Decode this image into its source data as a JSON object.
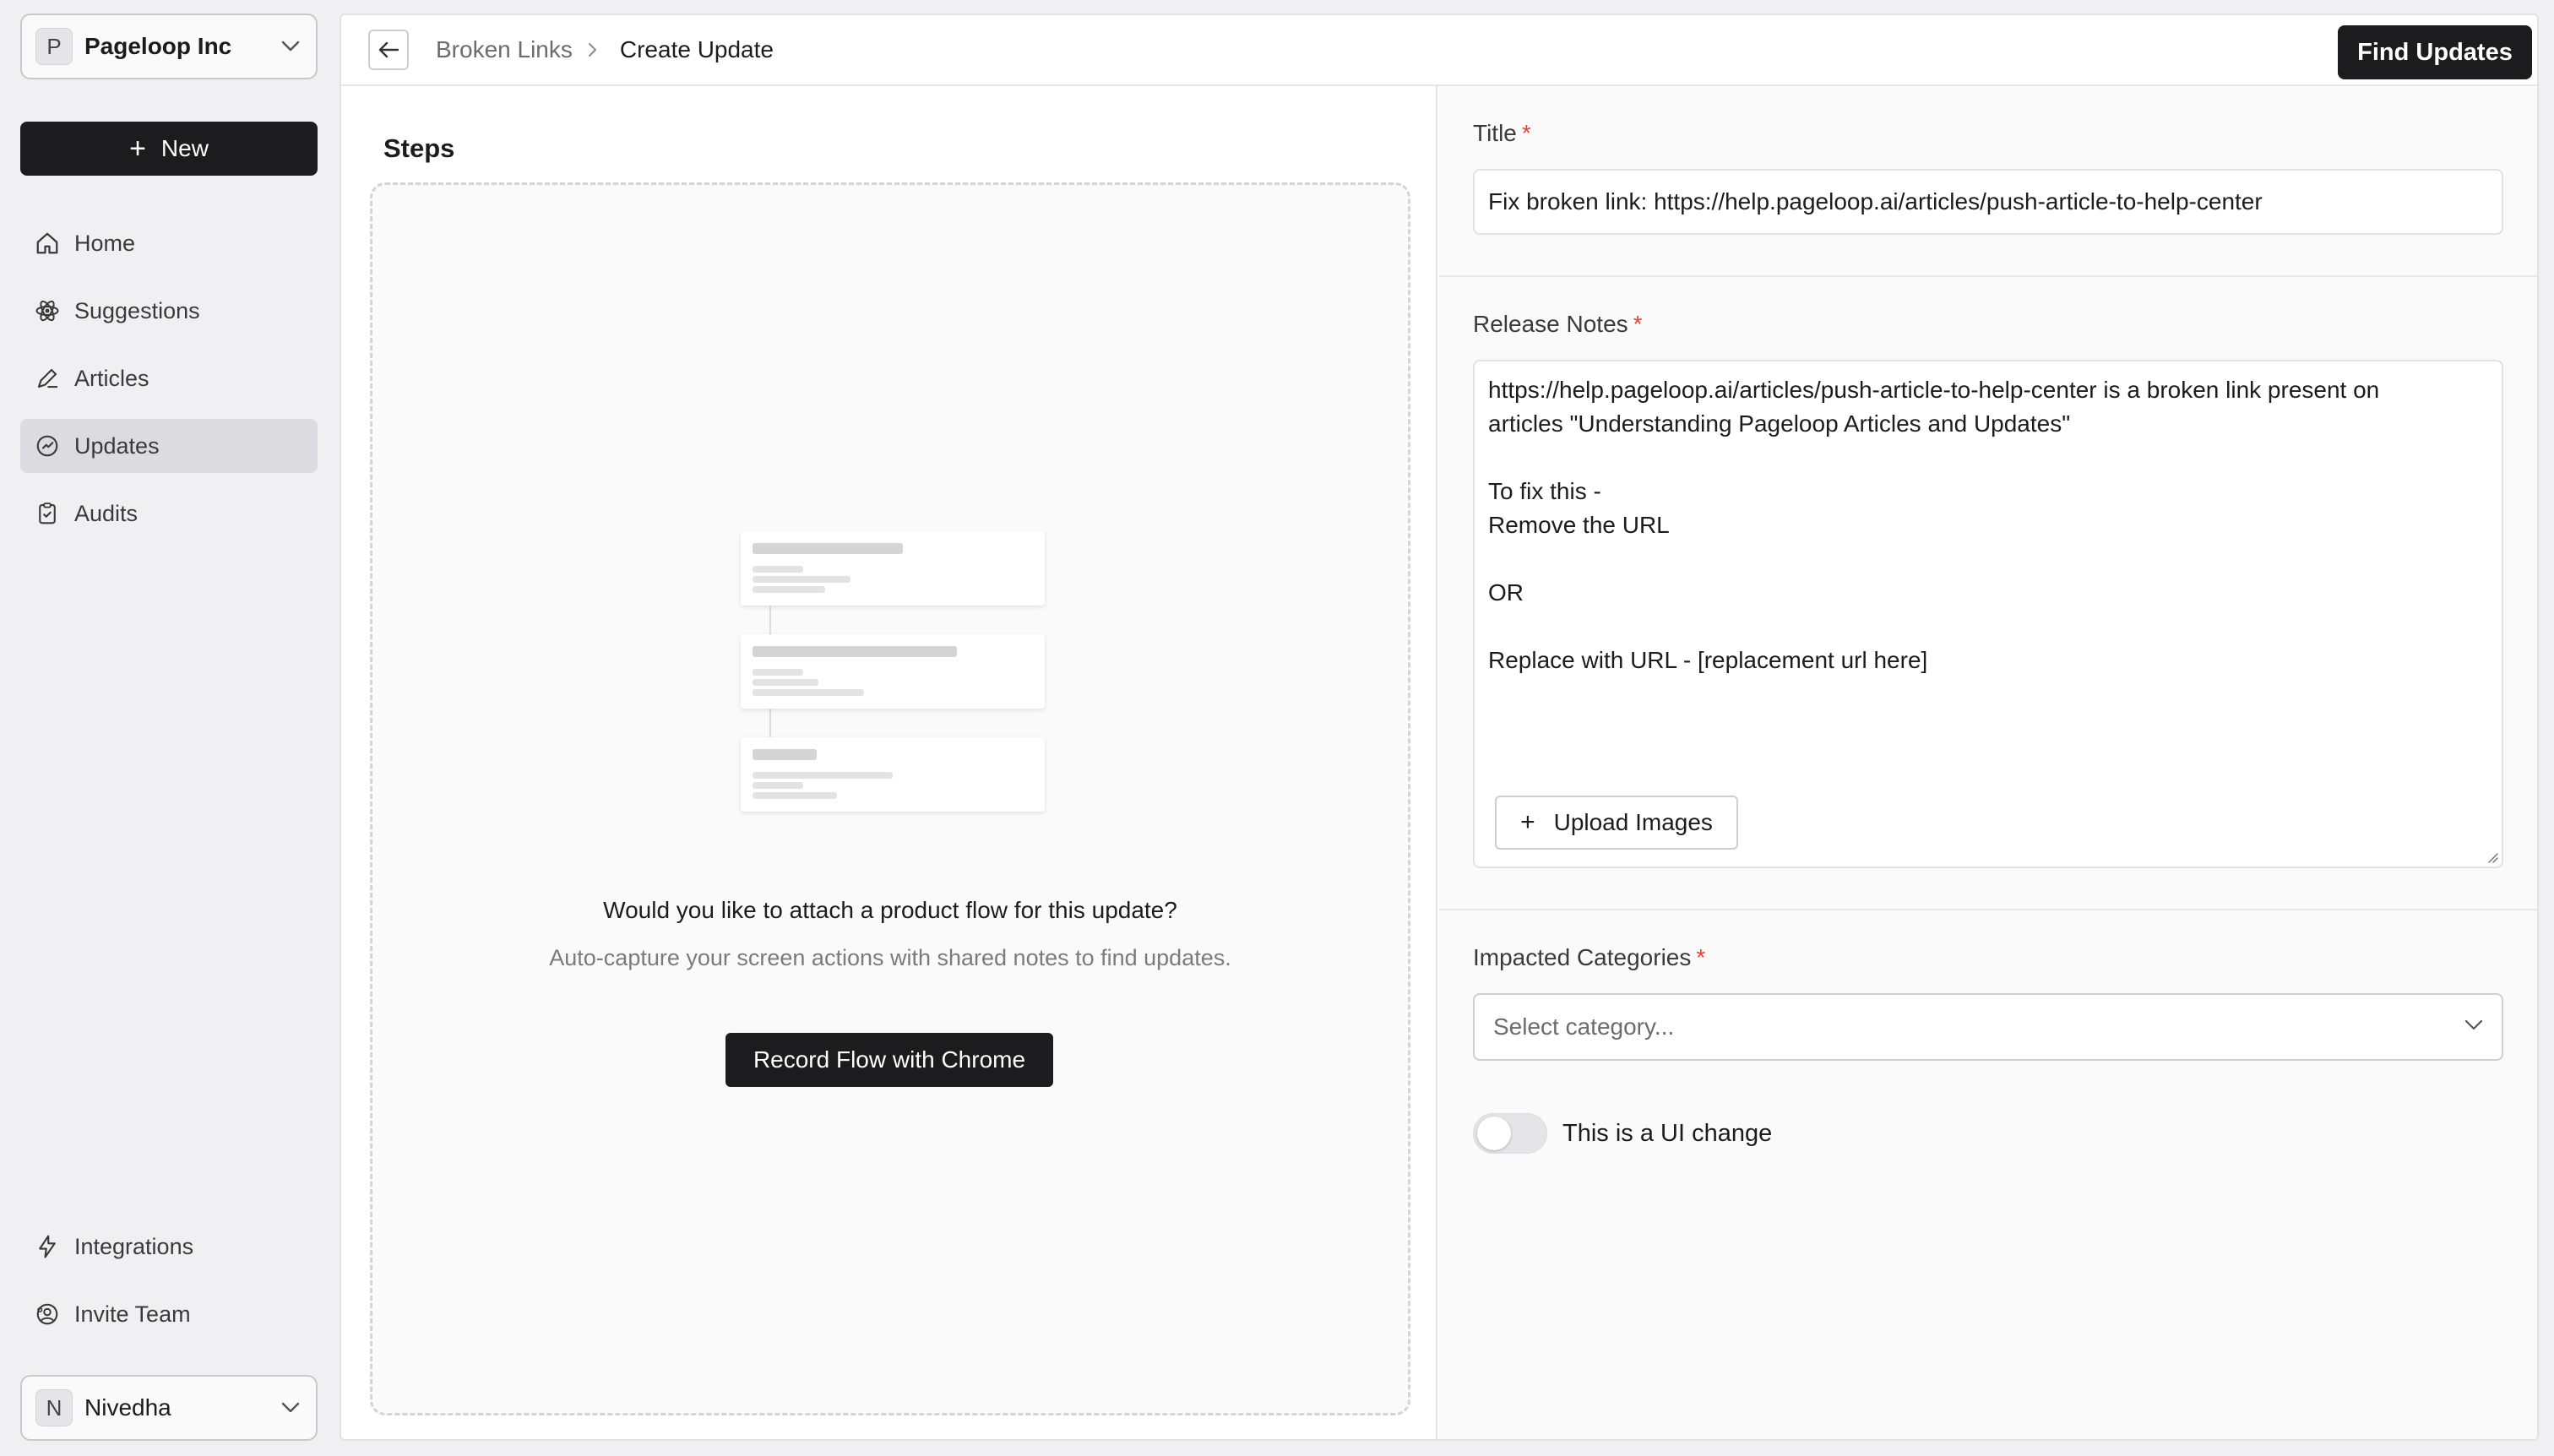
{
  "sidebar": {
    "org": {
      "initial": "P",
      "name": "Pageloop Inc"
    },
    "new_label": "New",
    "nav": [
      {
        "label": "Home",
        "icon": "home-icon"
      },
      {
        "label": "Suggestions",
        "icon": "atom-icon"
      },
      {
        "label": "Articles",
        "icon": "pen-icon"
      },
      {
        "label": "Updates",
        "icon": "refresh-icon",
        "active": true
      },
      {
        "label": "Audits",
        "icon": "clipboard-icon"
      }
    ],
    "bottom_nav": [
      {
        "label": "Integrations",
        "icon": "lightning-icon"
      },
      {
        "label": "Invite Team",
        "icon": "team-icon"
      }
    ],
    "user": {
      "initial": "N",
      "name": "Nivedha"
    }
  },
  "topbar": {
    "breadcrumb_parent": "Broken Links",
    "breadcrumb_current": "Create Update",
    "find_updates_label": "Find Updates"
  },
  "steps": {
    "title": "Steps",
    "question": "Would you like to attach a product flow for this update?",
    "subtitle": "Auto-capture your screen actions with shared notes to find updates.",
    "record_label": "Record Flow with Chrome"
  },
  "form": {
    "title_label": "Title",
    "title_value": "Fix broken link: https://help.pageloop.ai/articles/push-article-to-help-center",
    "release_notes_label": "Release Notes",
    "release_notes_value": "https://help.pageloop.ai/articles/push-article-to-help-center is a broken link present on\narticles \"Understanding Pageloop Articles and Updates\"\n\nTo fix this -\nRemove the URL\n\nOR\n\nReplace with URL - [replacement url here]",
    "upload_label": "Upload Images",
    "categories_label": "Impacted Categories",
    "categories_placeholder": "Select category...",
    "ui_change_label": "This is a UI change",
    "ui_change_on": false,
    "required_mark": "*"
  },
  "colors": {
    "primary": "#1c1c1e",
    "required": "#e0453c",
    "active_nav": "#dcdce0"
  }
}
